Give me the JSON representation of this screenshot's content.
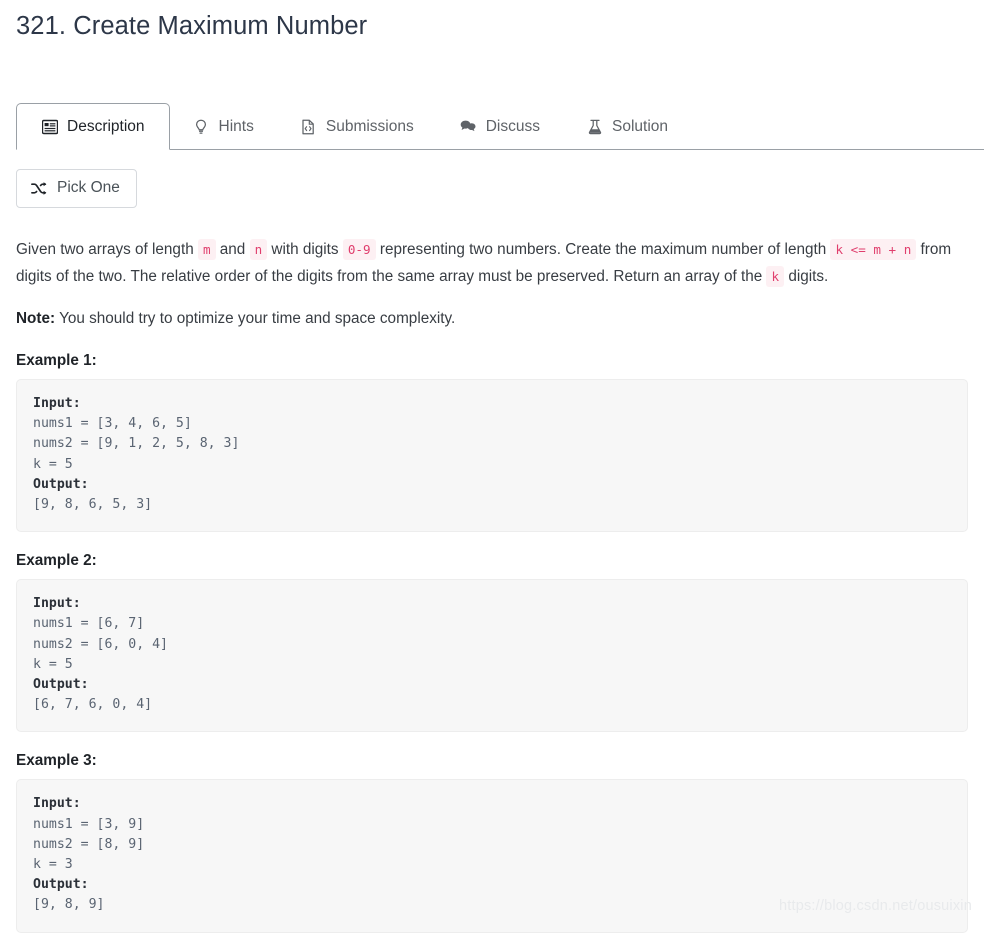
{
  "problem": {
    "title": "321. Create Maximum Number"
  },
  "tabs": [
    {
      "label": "Description",
      "icon": "description-icon",
      "active": true
    },
    {
      "label": "Hints",
      "icon": "lightbulb-icon",
      "active": false
    },
    {
      "label": "Submissions",
      "icon": "file-code-icon",
      "active": false
    },
    {
      "label": "Discuss",
      "icon": "speech-bubbles-icon",
      "active": false
    },
    {
      "label": "Solution",
      "icon": "flask-icon",
      "active": false
    }
  ],
  "toolbar": {
    "pick_one_label": "Pick One",
    "pick_one_icon": "shuffle-icon"
  },
  "description": {
    "para1": {
      "t1": "Given two arrays of length ",
      "c1": "m",
      "t2": " and ",
      "c2": "n",
      "t3": " with digits ",
      "c3": "0-9",
      "t4": " representing two numbers. Create the maximum number of length ",
      "c4": "k <= m + n",
      "t5": " from digits of the two. The relative order of the digits from the same array must be preserved. Return an array of the ",
      "c5": "k",
      "t6": " digits."
    },
    "note_label": "Note:",
    "note_text": " You should try to optimize your time and space complexity."
  },
  "examples": [
    {
      "heading": "Example 1:",
      "input_label": "Input:",
      "input_lines": "nums1 = [3, 4, 6, 5]\nnums2 = [9, 1, 2, 5, 8, 3]\nk = 5",
      "output_label": "Output:",
      "output_lines": "[9, 8, 6, 5, 3]"
    },
    {
      "heading": "Example 2:",
      "input_label": "Input:",
      "input_lines": "nums1 = [6, 7]\nnums2 = [6, 0, 4]\nk = 5",
      "output_label": "Output:",
      "output_lines": "[6, 7, 6, 0, 4]"
    },
    {
      "heading": "Example 3:",
      "input_label": "Input:",
      "input_lines": "nums1 = [3, 9]\nnums2 = [8, 9]\nk = 3",
      "output_label": "Output:",
      "output_lines": "[9, 8, 9]"
    }
  ],
  "watermark": {
    "text": "https://blog.csdn.net/ousuixin"
  },
  "colors": {
    "inline_code": "#e03e6d",
    "inline_code_bg": "#fdf0f3",
    "code_block_bg": "#f7f7f7",
    "tab_inactive": "#5f6368",
    "tab_active": "#1f2328"
  }
}
